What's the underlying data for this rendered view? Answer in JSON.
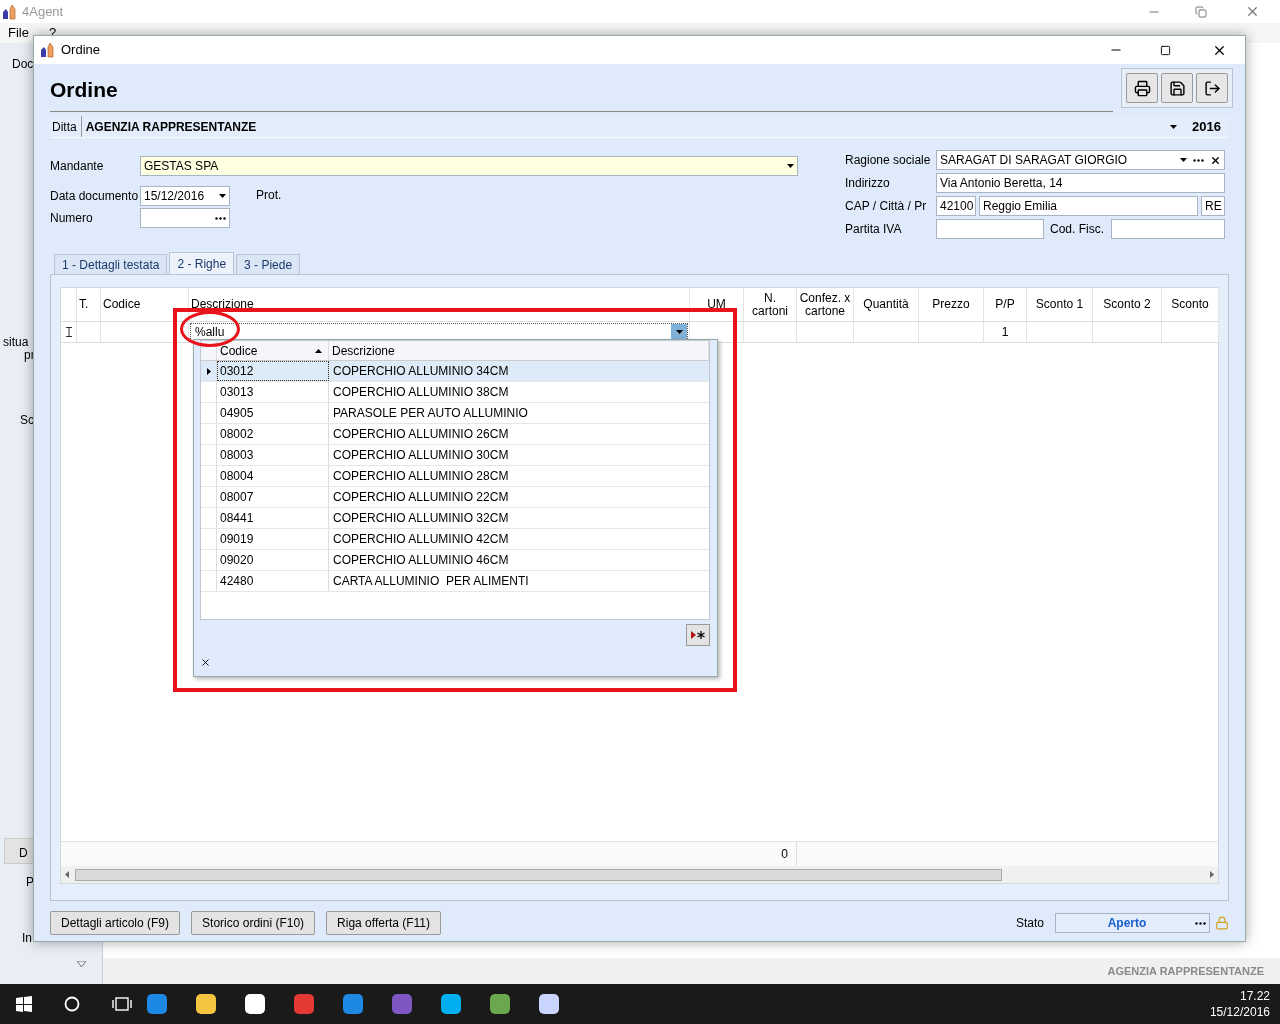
{
  "app": {
    "title": "4Agent",
    "menu": [
      "File",
      "?"
    ],
    "fragments": [
      "Doc",
      "situa",
      "pr",
      "Sc",
      "D",
      "P",
      "In"
    ],
    "footer": "AGENZIA RAPPRESENTANZE"
  },
  "dialog": {
    "title": "Ordine",
    "heading": "Ordine",
    "ditta": {
      "label": "Ditta",
      "value": "AGENZIA RAPPRESENTANZE",
      "year": "2016"
    },
    "fields_left": [
      {
        "label": "Mandante",
        "value": "GESTAS SPA",
        "kind": "dropdown",
        "highlight": true
      },
      {
        "label": "Data documento",
        "value": "15/12/2016",
        "kind": "dropdown",
        "highlight": false
      },
      {
        "label": "Numero",
        "kind": "lookup",
        "highlight": false
      }
    ],
    "prot": "Prot.",
    "customer": {
      "ragione_sociale": {
        "label": "Ragione sociale",
        "value": "SARAGAT DI SARAGAT GIORGIO"
      },
      "indirizzo": {
        "label": "Indirizzo",
        "value": "Via Antonio Beretta, 14"
      },
      "cap_citta_pr": {
        "label": "CAP / Città / Pr",
        "cap": "42100",
        "citta": "Reggio Emilia",
        "pr": "RE"
      },
      "partita_iva": {
        "label": "Partita IVA"
      },
      "cod_fisc": {
        "label": "Cod. Fisc."
      }
    },
    "tabs": [
      {
        "label": "1 - Dettagli testata",
        "selected": false
      },
      {
        "label": "2 - Righe",
        "selected": true
      },
      {
        "label": "3 - Piede",
        "selected": false
      }
    ],
    "grid": {
      "row_editing": true,
      "columns": [
        {},
        {
          "label": "T."
        },
        {
          "label": "Codice"
        },
        {
          "label": "Descrizione",
          "cell": {
            "value": "%allu",
            "kind": "combo"
          }
        },
        {
          "label": "UM"
        },
        {
          "label": "N. cartoni",
          "total": "0"
        },
        {
          "label": "Confez. x cartone"
        },
        {
          "label": "Quantità"
        },
        {
          "label": "Prezzo"
        },
        {
          "label": "P/P",
          "cell": {
            "value": "1",
            "kind": "text"
          }
        },
        {
          "label": "Sconto 1"
        },
        {
          "label": "Sconto 2"
        },
        {
          "label": "Sconto"
        }
      ]
    },
    "lookup": {
      "columns": [
        {
          "label": "Codice",
          "sorted": true
        },
        {
          "label": "Descrizione",
          "sorted": false
        }
      ],
      "rows": [
        {
          "codice": "03012",
          "descrizione": "COPERCHIO ALLUMINIO 34CM",
          "selected": true
        },
        {
          "codice": "03013",
          "descrizione": "COPERCHIO ALLUMINIO 38CM",
          "selected": false
        },
        {
          "codice": "04905",
          "descrizione": "PARASOLE PER AUTO ALLUMINIO",
          "selected": false
        },
        {
          "codice": "08002",
          "descrizione": "COPERCHIO ALLUMINIO 26CM",
          "selected": false
        },
        {
          "codice": "08003",
          "descrizione": "COPERCHIO ALLUMINIO 30CM",
          "selected": false
        },
        {
          "codice": "08004",
          "descrizione": "COPERCHIO ALLUMINIO 28CM",
          "selected": false
        },
        {
          "codice": "08007",
          "descrizione": "COPERCHIO ALLUMINIO 22CM",
          "selected": false
        },
        {
          "codice": "08441",
          "descrizione": "COPERCHIO ALLUMINIO 32CM",
          "selected": false
        },
        {
          "codice": "09019",
          "descrizione": "COPERCHIO ALLUMINIO 42CM",
          "selected": false
        },
        {
          "codice": "09020",
          "descrizione": "COPERCHIO ALLUMINIO 46CM",
          "selected": false
        },
        {
          "codice": "42480",
          "descrizione": "CARTA ALLUMINIO  PER ALIMENTI",
          "selected": false
        }
      ]
    },
    "buttons": [
      "Dettagli articolo (F9)",
      "Storico ordini (F10)",
      "Riga offerta (F11)"
    ],
    "status": {
      "label": "Stato",
      "value": "Aperto",
      "locked": true
    }
  },
  "taskbar": {
    "time": "17.22",
    "date": "15/12/2016"
  }
}
